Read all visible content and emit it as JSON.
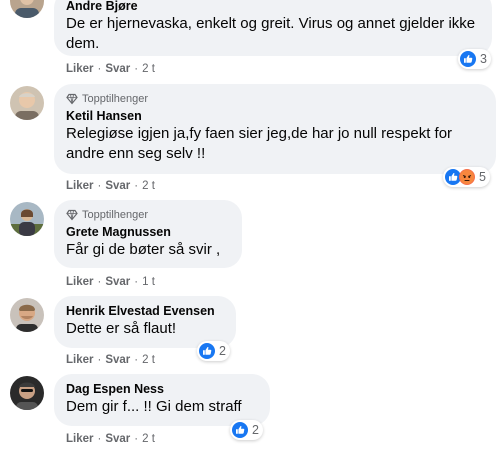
{
  "comments": [
    {
      "author": "Andre Bjøre",
      "text": "De er hjernevaska, enkelt og greit. Virus og annet gjelder ikke dem.",
      "like": "Liker",
      "reply": "Svar",
      "time": "2 t",
      "reactions": {
        "icons": [
          "like-icon"
        ],
        "count": "3"
      }
    },
    {
      "badge": "Topptilhenger",
      "author": "Ketil Hansen",
      "text": "Relegiøse igjen ja,fy faen sier jeg,de har jo null respekt for andre enn seg selv !!",
      "like": "Liker",
      "reply": "Svar",
      "time": "2 t",
      "reactions": {
        "icons": [
          "like-icon",
          "angry-icon"
        ],
        "count": "5"
      }
    },
    {
      "badge": "Topptilhenger",
      "author": "Grete Magnussen",
      "text": "Får gi de bøter så svir ,",
      "like": "Liker",
      "reply": "Svar",
      "time": "1 t"
    },
    {
      "author": "Henrik Elvestad Evensen",
      "text": "Dette er så flaut!",
      "like": "Liker",
      "reply": "Svar",
      "time": "2 t",
      "reactions": {
        "icons": [
          "like-icon"
        ],
        "count": "2"
      }
    },
    {
      "author": "Dag Espen Ness",
      "text": "Dem gir f... !! Gi dem straff",
      "like": "Liker",
      "reply": "Svar",
      "time": "2 t",
      "reactions": {
        "icons": [
          "like-icon"
        ],
        "count": "2"
      }
    }
  ],
  "colors": {
    "bubble": "#f0f2f5",
    "like_blue": "#1877f2",
    "angry_orange": "#f7714c",
    "meta_gray": "#65676b"
  }
}
